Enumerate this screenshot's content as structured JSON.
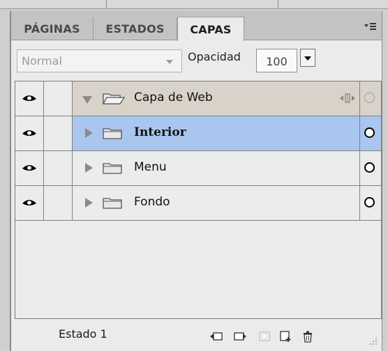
{
  "tabs": [
    {
      "label": "PÁGINAS"
    },
    {
      "label": "ESTADOS"
    },
    {
      "label": "CAPAS"
    }
  ],
  "controls": {
    "blend_mode": "Normal",
    "opacity_label": "Opacidad",
    "opacity_value": "100"
  },
  "layers": [
    {
      "name": "Capa de Web",
      "expanded": true,
      "bold": false,
      "selected": false,
      "visible": true,
      "icon": "folder-open-icon"
    },
    {
      "name": "Interior",
      "expanded": false,
      "bold": true,
      "selected": true,
      "visible": true,
      "icon": "folder-icon"
    },
    {
      "name": "Menu",
      "expanded": false,
      "bold": false,
      "selected": false,
      "visible": true,
      "icon": "folder-icon"
    },
    {
      "name": "Fondo",
      "expanded": false,
      "bold": false,
      "selected": false,
      "visible": true,
      "icon": "folder-icon"
    }
  ],
  "status": {
    "state_label": "Estado 1"
  },
  "colors": {
    "selected_row": "#a9c6ee",
    "web_layer_row": "#d8d2c8",
    "panel_bg": "#ebebeb"
  }
}
